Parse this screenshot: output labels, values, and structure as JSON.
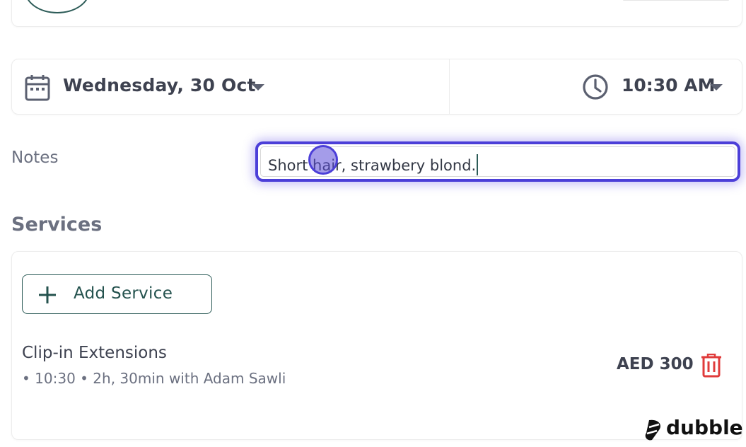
{
  "datetime": {
    "date_label": "Wednesday, 30 Oct",
    "time_label": "10:30 AM"
  },
  "notes": {
    "label": "Notes",
    "value": "Short hair, strawbery blond."
  },
  "services": {
    "title": "Services",
    "add_label": "Add Service",
    "items": [
      {
        "name": "Clip-in Extensions",
        "meta": "• 10:30 • 2h, 30min with Adam Sawli",
        "price": "AED 300"
      }
    ]
  },
  "watermark": {
    "text": "dubble"
  },
  "colors": {
    "accent": "#2d5c58",
    "focus": "#4c3fd8",
    "delete": "#e03b3b",
    "text": "#3e4250",
    "muted": "#6b7080"
  },
  "icons": [
    "calendar-icon",
    "caret-down-icon",
    "clock-icon",
    "plus-icon",
    "trash-icon",
    "dubble-logo-icon"
  ]
}
